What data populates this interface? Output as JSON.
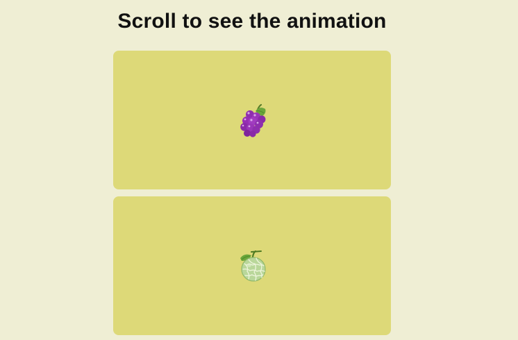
{
  "page": {
    "title": "Scroll to see the animation"
  },
  "cards": [
    {
      "icon": "grapes-icon"
    },
    {
      "icon": "melon-icon"
    }
  ],
  "colors": {
    "background": "#efeed4",
    "card": "#ddd978",
    "title": "#111111"
  }
}
